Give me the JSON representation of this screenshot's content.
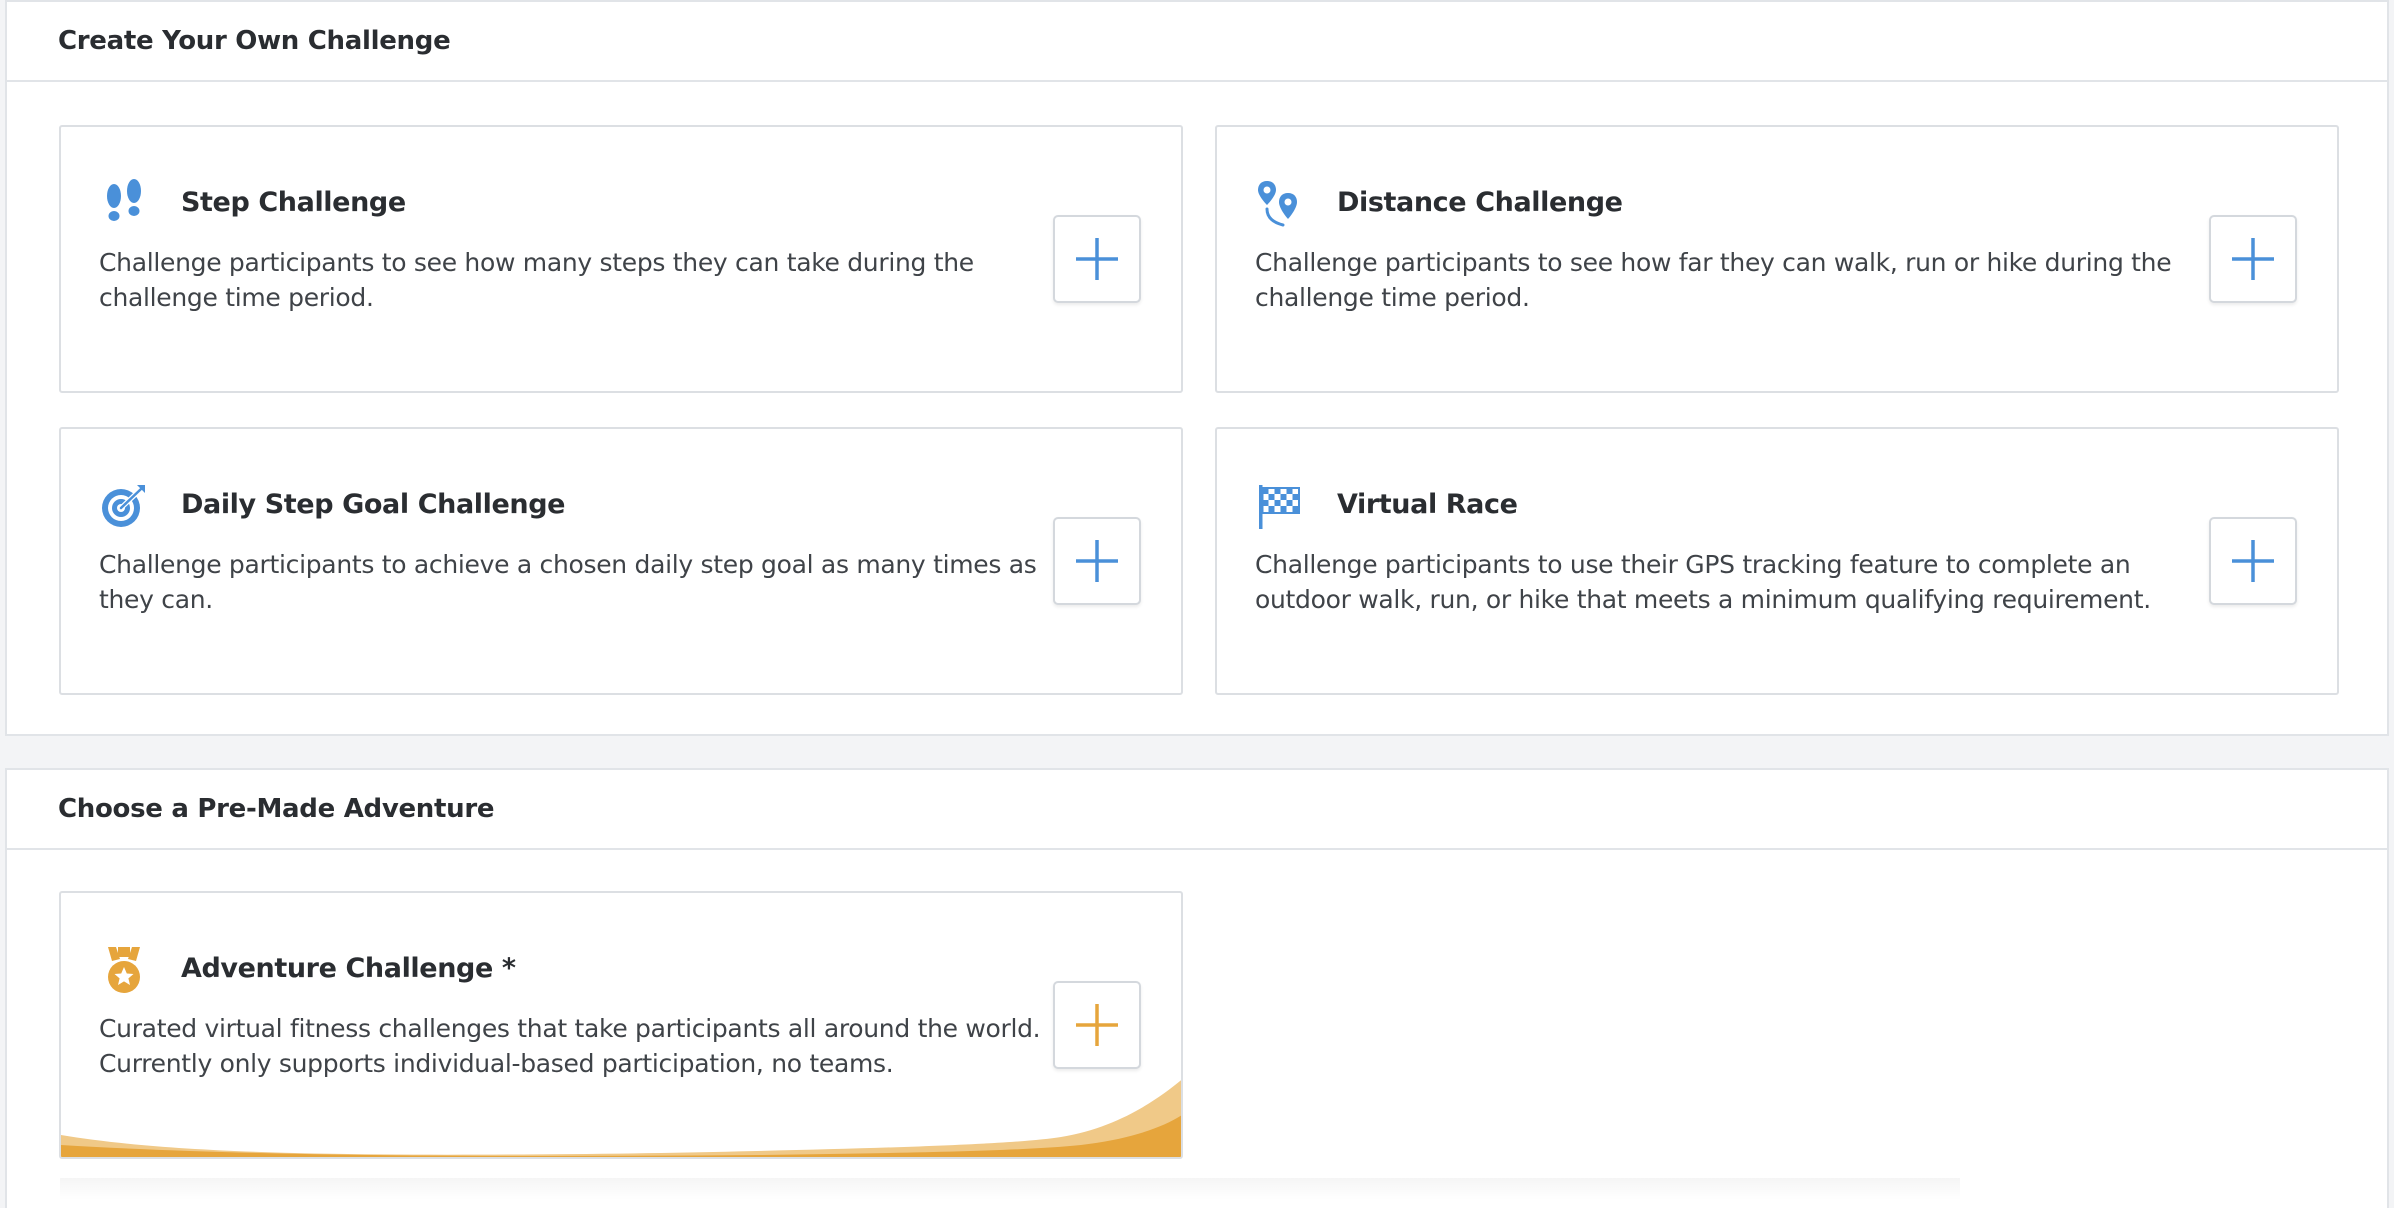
{
  "colors": {
    "accent_blue": "#4a90d9",
    "accent_gold": "#e6a53c",
    "gold_light": "#f0c988",
    "panel_border": "#e1e4e8"
  },
  "create_section": {
    "title": "Create Your Own Challenge",
    "cards": [
      {
        "icon": "footprints-icon",
        "title": "Step Challenge",
        "description": "Challenge participants to see how many steps they can take during the challenge time period."
      },
      {
        "icon": "map-pins-icon",
        "title": "Distance Challenge",
        "description": "Challenge participants to see how far they can walk, run or hike during the challenge time period."
      },
      {
        "icon": "target-arrow-icon",
        "title": "Daily Step Goal Challenge",
        "description": "Challenge participants to achieve a chosen daily step goal as many times as they can."
      },
      {
        "icon": "checkered-flag-icon",
        "title": "Virtual Race",
        "description": "Challenge participants to use their GPS tracking feature to complete an outdoor walk, run, or hike that meets a minimum qualifying requirement."
      }
    ]
  },
  "premade_section": {
    "title": "Choose a Pre-Made Adventure",
    "cards": [
      {
        "icon": "medal-icon",
        "title": "Adventure Challenge *",
        "description": "Curated virtual fitness challenges that take participants all around the world. Currently only supports individual-based participation, no teams."
      }
    ]
  }
}
